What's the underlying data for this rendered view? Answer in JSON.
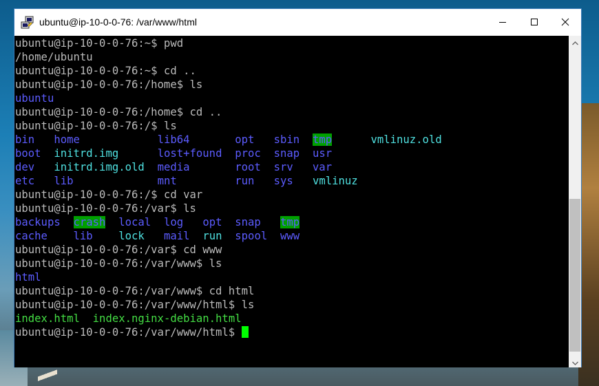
{
  "window": {
    "title": "ubuntu@ip-10-0-0-76: /var/www/html"
  },
  "icons": {
    "app": "putty-icon",
    "minimize": "minimize-icon",
    "maximize": "maximize-icon",
    "close": "close-icon",
    "scroll_up": "scroll-up-icon",
    "scroll_down": "scroll-down-icon"
  },
  "terminal": {
    "lines": [
      [
        {
          "t": "ubuntu@ip-10-0-0-76:~$ pwd",
          "c": ""
        }
      ],
      [
        {
          "t": "/home/ubuntu",
          "c": ""
        }
      ],
      [
        {
          "t": "ubuntu@ip-10-0-0-76:~$ cd ..",
          "c": ""
        }
      ],
      [
        {
          "t": "ubuntu@ip-10-0-0-76:/home$ ls",
          "c": ""
        }
      ],
      [
        {
          "t": "ubuntu",
          "c": "blue"
        }
      ],
      [
        {
          "t": "ubuntu@ip-10-0-0-76:/home$ cd ..",
          "c": ""
        }
      ],
      [
        {
          "t": "ubuntu@ip-10-0-0-76:/$ ls",
          "c": ""
        }
      ],
      [
        {
          "t": "bin",
          "c": "blue"
        },
        {
          "t": "   ",
          "c": ""
        },
        {
          "t": "home",
          "c": "blue"
        },
        {
          "t": "            ",
          "c": ""
        },
        {
          "t": "lib64",
          "c": "blue"
        },
        {
          "t": "       ",
          "c": ""
        },
        {
          "t": "opt",
          "c": "blue"
        },
        {
          "t": "   ",
          "c": ""
        },
        {
          "t": "sbin",
          "c": "blue"
        },
        {
          "t": "  ",
          "c": ""
        },
        {
          "t": "tmp",
          "c": "hl"
        },
        {
          "t": "      ",
          "c": ""
        },
        {
          "t": "vmlinuz.old",
          "c": "cyan"
        }
      ],
      [
        {
          "t": "boot",
          "c": "blue"
        },
        {
          "t": "  ",
          "c": ""
        },
        {
          "t": "initrd.img",
          "c": "cyan"
        },
        {
          "t": "      ",
          "c": ""
        },
        {
          "t": "lost+found",
          "c": "blue"
        },
        {
          "t": "  ",
          "c": ""
        },
        {
          "t": "proc",
          "c": "blue"
        },
        {
          "t": "  ",
          "c": ""
        },
        {
          "t": "snap",
          "c": "blue"
        },
        {
          "t": "  ",
          "c": ""
        },
        {
          "t": "usr",
          "c": "blue"
        }
      ],
      [
        {
          "t": "dev",
          "c": "blue"
        },
        {
          "t": "   ",
          "c": ""
        },
        {
          "t": "initrd.img.old",
          "c": "cyan"
        },
        {
          "t": "  ",
          "c": ""
        },
        {
          "t": "media",
          "c": "blue"
        },
        {
          "t": "       ",
          "c": ""
        },
        {
          "t": "root",
          "c": "blue"
        },
        {
          "t": "  ",
          "c": ""
        },
        {
          "t": "srv",
          "c": "blue"
        },
        {
          "t": "   ",
          "c": ""
        },
        {
          "t": "var",
          "c": "blue"
        }
      ],
      [
        {
          "t": "etc",
          "c": "blue"
        },
        {
          "t": "   ",
          "c": ""
        },
        {
          "t": "lib",
          "c": "blue"
        },
        {
          "t": "             ",
          "c": ""
        },
        {
          "t": "mnt",
          "c": "blue"
        },
        {
          "t": "         ",
          "c": ""
        },
        {
          "t": "run",
          "c": "blue"
        },
        {
          "t": "   ",
          "c": ""
        },
        {
          "t": "sys",
          "c": "blue"
        },
        {
          "t": "   ",
          "c": ""
        },
        {
          "t": "vmlinuz",
          "c": "cyan"
        }
      ],
      [
        {
          "t": "ubuntu@ip-10-0-0-76:/$ cd var",
          "c": ""
        }
      ],
      [
        {
          "t": "ubuntu@ip-10-0-0-76:/var$ ls",
          "c": ""
        }
      ],
      [
        {
          "t": "backups",
          "c": "blue"
        },
        {
          "t": "  ",
          "c": ""
        },
        {
          "t": "crash",
          "c": "hl"
        },
        {
          "t": "  ",
          "c": ""
        },
        {
          "t": "local",
          "c": "blue"
        },
        {
          "t": "  ",
          "c": ""
        },
        {
          "t": "log",
          "c": "blue"
        },
        {
          "t": "   ",
          "c": ""
        },
        {
          "t": "opt",
          "c": "blue"
        },
        {
          "t": "  ",
          "c": ""
        },
        {
          "t": "snap",
          "c": "blue"
        },
        {
          "t": "   ",
          "c": ""
        },
        {
          "t": "tmp",
          "c": "hl"
        }
      ],
      [
        {
          "t": "cache",
          "c": "blue"
        },
        {
          "t": "    ",
          "c": ""
        },
        {
          "t": "lib",
          "c": "blue"
        },
        {
          "t": "    ",
          "c": ""
        },
        {
          "t": "lock",
          "c": "cyan"
        },
        {
          "t": "   ",
          "c": ""
        },
        {
          "t": "mail",
          "c": "blue"
        },
        {
          "t": "  ",
          "c": ""
        },
        {
          "t": "run",
          "c": "cyan"
        },
        {
          "t": "  ",
          "c": ""
        },
        {
          "t": "spool",
          "c": "blue"
        },
        {
          "t": "  ",
          "c": ""
        },
        {
          "t": "www",
          "c": "blue"
        }
      ],
      [
        {
          "t": "ubuntu@ip-10-0-0-76:/var$ cd www",
          "c": ""
        }
      ],
      [
        {
          "t": "ubuntu@ip-10-0-0-76:/var/www$ ls",
          "c": ""
        }
      ],
      [
        {
          "t": "html",
          "c": "blue"
        }
      ],
      [
        {
          "t": "ubuntu@ip-10-0-0-76:/var/www$ cd html",
          "c": ""
        }
      ],
      [
        {
          "t": "ubuntu@ip-10-0-0-76:/var/www/html$ ls",
          "c": ""
        }
      ],
      [
        {
          "t": "index.html",
          "c": "green"
        },
        {
          "t": "  ",
          "c": ""
        },
        {
          "t": "index.nginx-debian.html",
          "c": "green"
        }
      ],
      [
        {
          "t": "ubuntu@ip-10-0-0-76:/var/www/html$ ",
          "c": ""
        }
      ]
    ]
  }
}
